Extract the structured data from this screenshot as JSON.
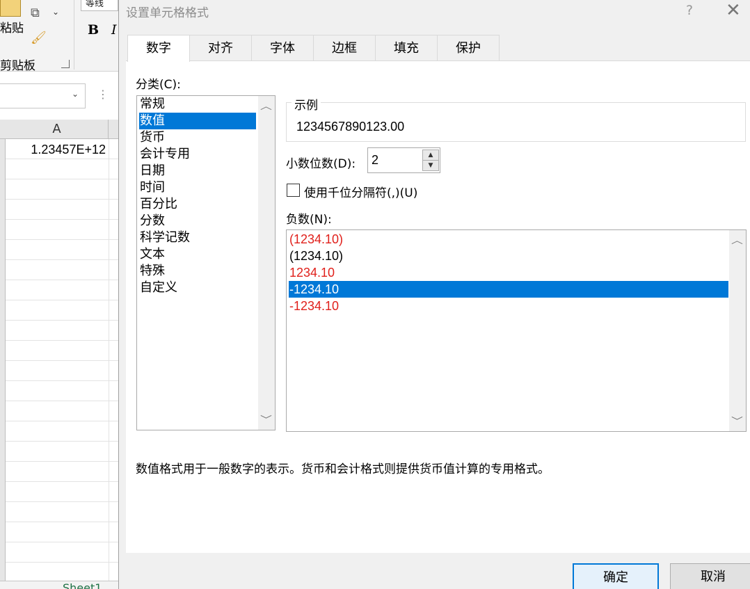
{
  "excel": {
    "paste_label": "粘贴",
    "clipboard_label": "剪贴板",
    "font_name": "等线",
    "bold": "B",
    "italic": "I",
    "column_header": "A",
    "cell_a1": "1.23457E+12",
    "sheet_tab": "Sheet1"
  },
  "dialog": {
    "title": "设置单元格格式",
    "help": "?",
    "close": "✕",
    "tabs": [
      {
        "label": "数字",
        "active": true
      },
      {
        "label": "对齐",
        "active": false
      },
      {
        "label": "字体",
        "active": false
      },
      {
        "label": "边框",
        "active": false
      },
      {
        "label": "填充",
        "active": false
      },
      {
        "label": "保护",
        "active": false
      }
    ],
    "category_label": "分类(C):",
    "categories": [
      {
        "label": "常规",
        "selected": false
      },
      {
        "label": "数值",
        "selected": true
      },
      {
        "label": "货币",
        "selected": false
      },
      {
        "label": "会计专用",
        "selected": false
      },
      {
        "label": "日期",
        "selected": false
      },
      {
        "label": "时间",
        "selected": false
      },
      {
        "label": "百分比",
        "selected": false
      },
      {
        "label": "分数",
        "selected": false
      },
      {
        "label": "科学记数",
        "selected": false
      },
      {
        "label": "文本",
        "selected": false
      },
      {
        "label": "特殊",
        "selected": false
      },
      {
        "label": "自定义",
        "selected": false
      }
    ],
    "sample_label": "示例",
    "sample_value": "1234567890123.00",
    "decimal_places_label": "小数位数(D):",
    "decimal_places_value": "2",
    "thousands_separator_label": "使用千位分隔符(,)(U)",
    "thousands_separator_checked": false,
    "negative_label": "负数(N):",
    "negative_formats": [
      {
        "label": "(1234.10)",
        "color": "#e0201b",
        "selected": false
      },
      {
        "label": "(1234.10)",
        "color": "#000000",
        "selected": false
      },
      {
        "label": "1234.10",
        "color": "#e0201b",
        "selected": false
      },
      {
        "label": "-1234.10",
        "color": "#ffffff",
        "selected": true
      },
      {
        "label": "-1234.10",
        "color": "#e0201b",
        "selected": false
      }
    ],
    "description": "数值格式用于一般数字的表示。货币和会计格式则提供货币值计算的专用格式。",
    "ok_label": "确定",
    "cancel_label": "取消",
    "accent_color": "#0078d7"
  }
}
